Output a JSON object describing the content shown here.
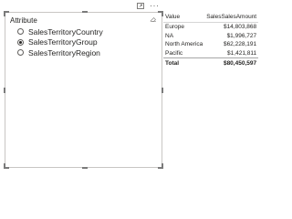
{
  "visual_header": {
    "focus_icon": "focus-mode-icon",
    "more_label": "···"
  },
  "slicer": {
    "header": "Attribute",
    "options": [
      {
        "label": "SalesTerritoryCountry",
        "selected": false
      },
      {
        "label": "SalesTerritoryGroup",
        "selected": true
      },
      {
        "label": "SalesTerritoryRegion",
        "selected": false
      }
    ]
  },
  "table": {
    "columns": [
      "Value",
      "SalesSalesAmount"
    ],
    "rows": [
      {
        "value": "Europe",
        "amount": "$14,803,868"
      },
      {
        "value": "NA",
        "amount": "$1,996,727"
      },
      {
        "value": "North America",
        "amount": "$62,228,191"
      },
      {
        "value": "Pacific",
        "amount": "$1,421,811"
      }
    ],
    "total": {
      "label": "Total",
      "amount": "$80,450,597"
    }
  }
}
